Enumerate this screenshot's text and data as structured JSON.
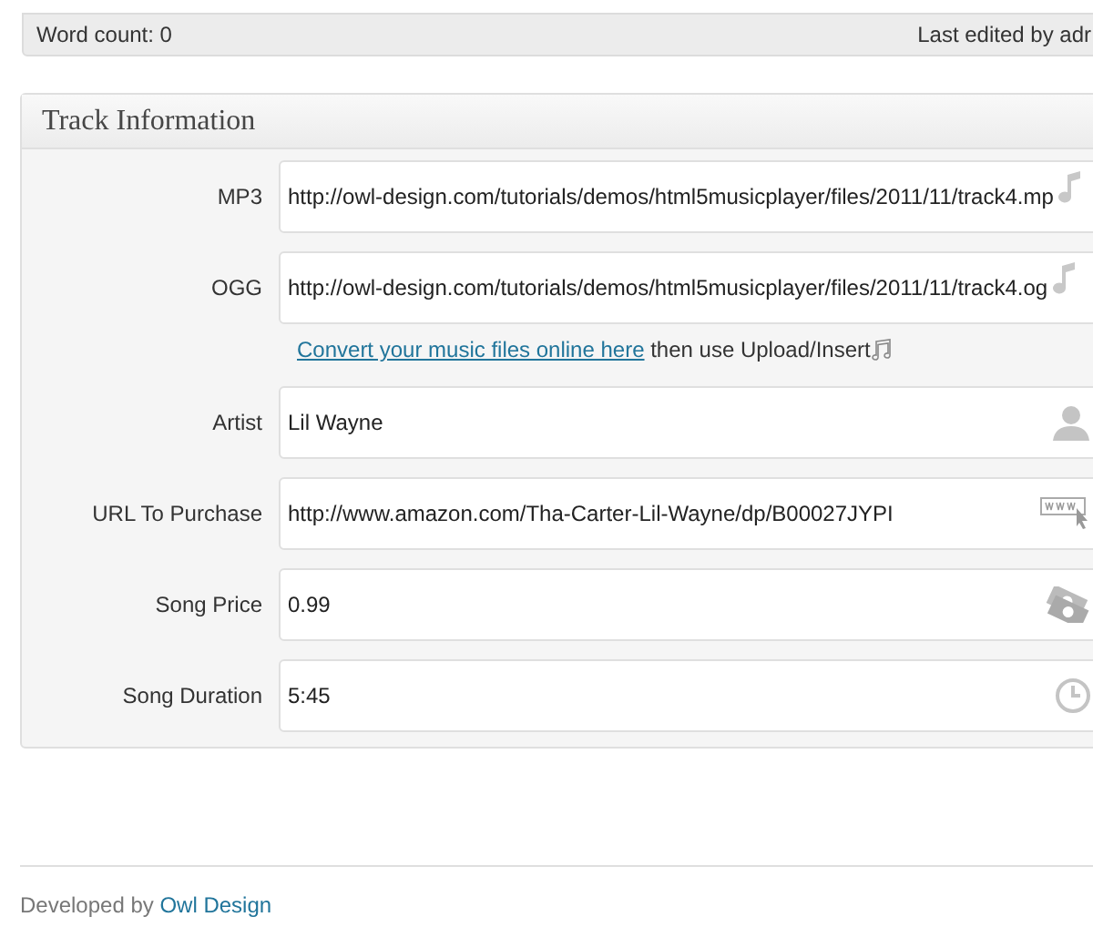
{
  "editor_status": {
    "word_count": "Word count: 0",
    "last_edited": "Last edited by adr"
  },
  "panel": {
    "title": "Track Information",
    "fields": [
      {
        "label": "MP3",
        "value": "http://owl-design.com/tutorials/demos/html5musicplayer/files/2011/11/track4.mp",
        "kind": "music"
      },
      {
        "label": "OGG",
        "value": "http://owl-design.com/tutorials/demos/html5musicplayer/files/2011/11/track4.og",
        "kind": "music",
        "help": {
          "link": "Convert your music files online here",
          "text": "then use Upload/Insert"
        }
      },
      {
        "label": "Artist",
        "value": "Lil Wayne",
        "kind": "person"
      },
      {
        "label": "URL To Purchase",
        "value": "http://www.amazon.com/Tha-Carter-Lil-Wayne/dp/B00027JYPI",
        "kind": "web"
      },
      {
        "label": "Song Price",
        "value": "0.99",
        "kind": "money"
      },
      {
        "label": "Song Duration",
        "value": "5:45",
        "kind": "clock"
      }
    ]
  },
  "footer": {
    "text": "Developed by",
    "link": "Owl Design"
  }
}
